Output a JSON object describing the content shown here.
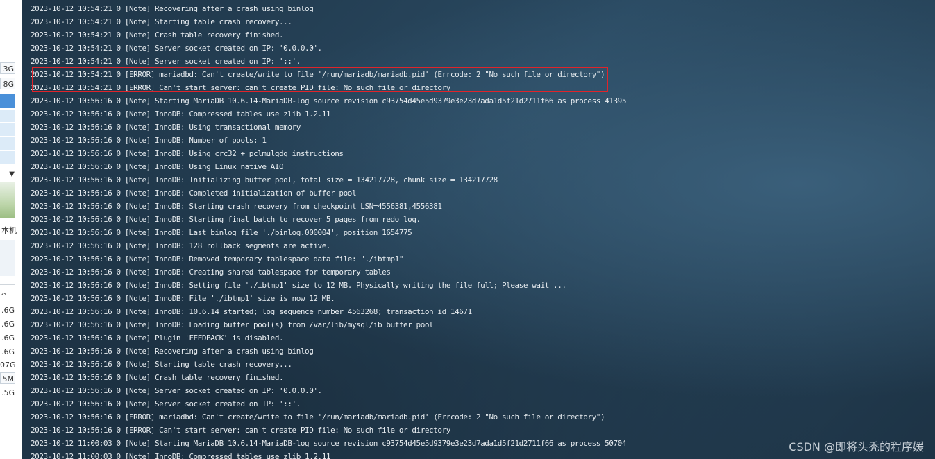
{
  "left_panel": {
    "items": [
      {
        "name": "size-3g",
        "text": "3G"
      },
      {
        "name": "size-8g",
        "text": "8G"
      },
      {
        "name": "label-machine",
        "text": "本机"
      },
      {
        "name": "size-6g-1",
        "text": ".6G"
      },
      {
        "name": "size-6g-2",
        "text": ".6G"
      },
      {
        "name": "size-6g-3",
        "text": ".6G"
      },
      {
        "name": "size-6g-4",
        "text": ".6G"
      },
      {
        "name": "size-07g",
        "text": "07G"
      },
      {
        "name": "size-5m",
        "text": "5M"
      },
      {
        "name": "size-5g",
        "text": ".5G"
      }
    ]
  },
  "terminal": {
    "lines": [
      "2023-10-12 10:54:21 0 [Note] Recovering after a crash using binlog",
      "2023-10-12 10:54:21 0 [Note] Starting table crash recovery...",
      "2023-10-12 10:54:21 0 [Note] Crash table recovery finished.",
      "2023-10-12 10:54:21 0 [Note] Server socket created on IP: '0.0.0.0'.",
      "2023-10-12 10:54:21 0 [Note] Server socket created on IP: '::'.",
      "2023-10-12 10:54:21 0 [ERROR] mariadbd: Can't create/write to file '/run/mariadb/mariadb.pid' (Errcode: 2 \"No such file or directory\")",
      "2023-10-12 10:54:21 0 [ERROR] Can't start server: can't create PID file: No such file or directory",
      "2023-10-12 10:56:16 0 [Note] Starting MariaDB 10.6.14-MariaDB-log source revision c93754d45e5d9379e3e23d7ada1d5f21d2711f66 as process 41395",
      "2023-10-12 10:56:16 0 [Note] InnoDB: Compressed tables use zlib 1.2.11",
      "2023-10-12 10:56:16 0 [Note] InnoDB: Using transactional memory",
      "2023-10-12 10:56:16 0 [Note] InnoDB: Number of pools: 1",
      "2023-10-12 10:56:16 0 [Note] InnoDB: Using crc32 + pclmulqdq instructions",
      "2023-10-12 10:56:16 0 [Note] InnoDB: Using Linux native AIO",
      "2023-10-12 10:56:16 0 [Note] InnoDB: Initializing buffer pool, total size = 134217728, chunk size = 134217728",
      "2023-10-12 10:56:16 0 [Note] InnoDB: Completed initialization of buffer pool",
      "2023-10-12 10:56:16 0 [Note] InnoDB: Starting crash recovery from checkpoint LSN=4556381,4556381",
      "2023-10-12 10:56:16 0 [Note] InnoDB: Starting final batch to recover 5 pages from redo log.",
      "2023-10-12 10:56:16 0 [Note] InnoDB: Last binlog file './binlog.000004', position 1654775",
      "2023-10-12 10:56:16 0 [Note] InnoDB: 128 rollback segments are active.",
      "2023-10-12 10:56:16 0 [Note] InnoDB: Removed temporary tablespace data file: \"./ibtmp1\"",
      "2023-10-12 10:56:16 0 [Note] InnoDB: Creating shared tablespace for temporary tables",
      "2023-10-12 10:56:16 0 [Note] InnoDB: Setting file './ibtmp1' size to 12 MB. Physically writing the file full; Please wait ...",
      "2023-10-12 10:56:16 0 [Note] InnoDB: File './ibtmp1' size is now 12 MB.",
      "2023-10-12 10:56:16 0 [Note] InnoDB: 10.6.14 started; log sequence number 4563268; transaction id 14671",
      "2023-10-12 10:56:16 0 [Note] InnoDB: Loading buffer pool(s) from /var/lib/mysql/ib_buffer_pool",
      "2023-10-12 10:56:16 0 [Note] Plugin 'FEEDBACK' is disabled.",
      "2023-10-12 10:56:16 0 [Note] Recovering after a crash using binlog",
      "2023-10-12 10:56:16 0 [Note] Starting table crash recovery...",
      "2023-10-12 10:56:16 0 [Note] Crash table recovery finished.",
      "2023-10-12 10:56:16 0 [Note] Server socket created on IP: '0.0.0.0'.",
      "2023-10-12 10:56:16 0 [Note] Server socket created on IP: '::'.",
      "2023-10-12 10:56:16 0 [ERROR] mariadbd: Can't create/write to file '/run/mariadb/mariadb.pid' (Errcode: 2 \"No such file or directory\")",
      "2023-10-12 10:56:16 0 [ERROR] Can't start server: can't create PID file: No such file or directory",
      "2023-10-12 11:00:03 0 [Note] Starting MariaDB 10.6.14-MariaDB-log source revision c93754d45e5d9379e3e23d7ada1d5f21d2711f66 as process 50704",
      "2023-10-12 11:00:03 0 [Note] InnoDB: Compressed tables use zlib 1.2.11"
    ]
  },
  "watermark": "CSDN @即将头秃的程序媛",
  "colors": {
    "terminal_text": "#e6ebef",
    "highlight_border": "#e0242a",
    "terminal_bg": "#2a4a62"
  }
}
